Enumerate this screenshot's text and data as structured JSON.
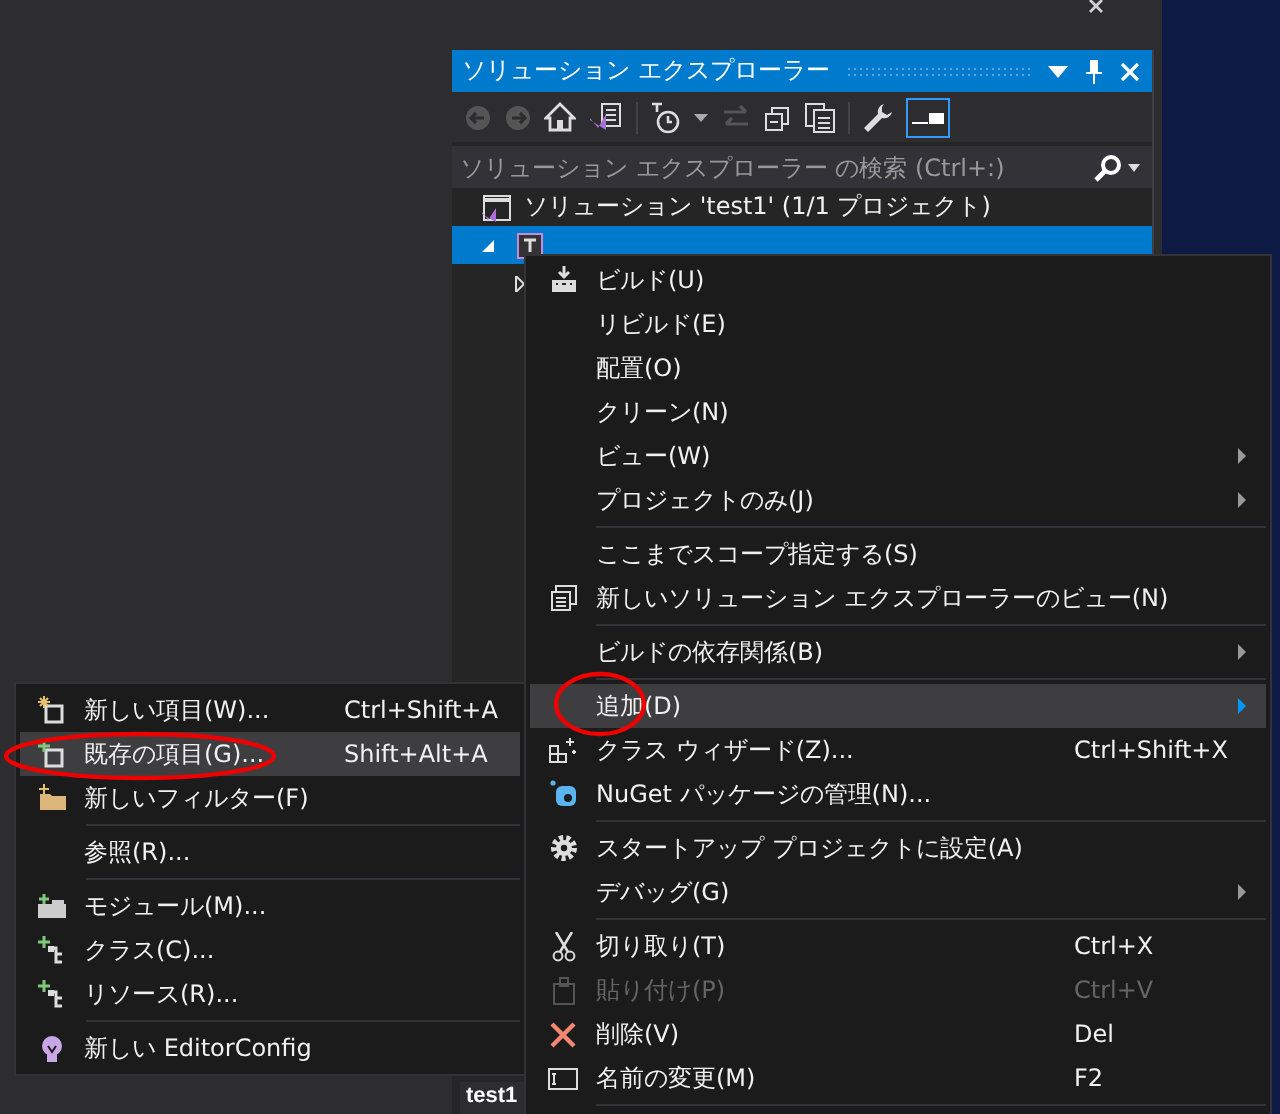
{
  "panel": {
    "title": "ソリューション エクスプローラー",
    "search": {
      "placeholder": "ソリューション エクスプローラー の検索 (Ctrl+:)"
    }
  },
  "tree": [
    {
      "label": "ソリューション 'test1' (1/1 プロジェクト)",
      "selected": false,
      "children": [
        {
          "selected": true,
          "expanded": true,
          "children": [
            {
              "expanded": false
            }
          ]
        }
      ]
    }
  ],
  "context_menu": [
    {
      "kind": "item",
      "label": "ビルド(U)",
      "selected": false,
      "disabled": false,
      "submenu": false
    },
    {
      "kind": "item",
      "label": "リビルド(E)",
      "selected": false,
      "disabled": false,
      "submenu": false
    },
    {
      "kind": "item",
      "label": "配置(O)",
      "selected": false,
      "disabled": false,
      "submenu": false
    },
    {
      "kind": "item",
      "label": "クリーン(N)",
      "selected": false,
      "disabled": false,
      "submenu": false
    },
    {
      "kind": "item",
      "label": "ビュー(W)",
      "selected": false,
      "disabled": false,
      "submenu": true
    },
    {
      "kind": "item",
      "label": "プロジェクトのみ(J)",
      "selected": false,
      "disabled": false,
      "submenu": true
    },
    {
      "kind": "separator"
    },
    {
      "kind": "item",
      "label": "ここまでスコープ指定する(S)",
      "selected": false,
      "disabled": false,
      "submenu": false
    },
    {
      "kind": "item",
      "label": "新しいソリューション エクスプローラーのビュー(N)",
      "selected": false,
      "disabled": false,
      "submenu": false
    },
    {
      "kind": "separator"
    },
    {
      "kind": "item",
      "label": "ビルドの依存関係(B)",
      "selected": false,
      "disabled": false,
      "submenu": true
    },
    {
      "kind": "separator"
    },
    {
      "kind": "item",
      "label": "追加(D)",
      "selected": true,
      "disabled": false,
      "submenu": true
    },
    {
      "kind": "item",
      "label": "クラス ウィザード(Z)...",
      "shortcut": "Ctrl+Shift+X",
      "selected": false,
      "disabled": false,
      "submenu": false
    },
    {
      "kind": "item",
      "label": "NuGet パッケージの管理(N)...",
      "selected": false,
      "disabled": false,
      "submenu": false
    },
    {
      "kind": "separator"
    },
    {
      "kind": "item",
      "label": "スタートアップ プロジェクトに設定(A)",
      "selected": false,
      "disabled": false,
      "submenu": false
    },
    {
      "kind": "item",
      "label": "デバッグ(G)",
      "selected": false,
      "disabled": false,
      "submenu": true
    },
    {
      "kind": "separator"
    },
    {
      "kind": "item",
      "label": "切り取り(T)",
      "shortcut": "Ctrl+X",
      "selected": false,
      "disabled": false,
      "submenu": false
    },
    {
      "kind": "item",
      "label": "貼り付け(P)",
      "shortcut": "Ctrl+V",
      "selected": false,
      "disabled": true,
      "submenu": false
    },
    {
      "kind": "item",
      "label": "削除(V)",
      "shortcut": "Del",
      "selected": false,
      "disabled": false,
      "submenu": false
    },
    {
      "kind": "item",
      "label": "名前の変更(M)",
      "shortcut": "F2",
      "selected": false,
      "disabled": false,
      "submenu": false
    },
    {
      "kind": "separator"
    }
  ],
  "add_submenu": [
    {
      "kind": "item",
      "label": "新しい項目(W)...",
      "shortcut": "Ctrl+Shift+A",
      "selected": false
    },
    {
      "kind": "item",
      "label": "既存の項目(G)...",
      "shortcut": "Shift+Alt+A",
      "selected": true
    },
    {
      "kind": "item",
      "label": "新しいフィルター(F)",
      "selected": false
    },
    {
      "kind": "separator"
    },
    {
      "kind": "item",
      "label": "参照(R)...",
      "selected": false
    },
    {
      "kind": "separator"
    },
    {
      "kind": "item",
      "label": "モジュール(M)...",
      "selected": false
    },
    {
      "kind": "item",
      "label": "クラス(C)...",
      "selected": false
    },
    {
      "kind": "item",
      "label": "リソース(R)...",
      "selected": false
    },
    {
      "kind": "separator"
    },
    {
      "kind": "item",
      "label": "新しい EditorConfig",
      "selected": false
    }
  ],
  "bottom_tabs": [
    {
      "label": "test1",
      "selected": true
    }
  ]
}
